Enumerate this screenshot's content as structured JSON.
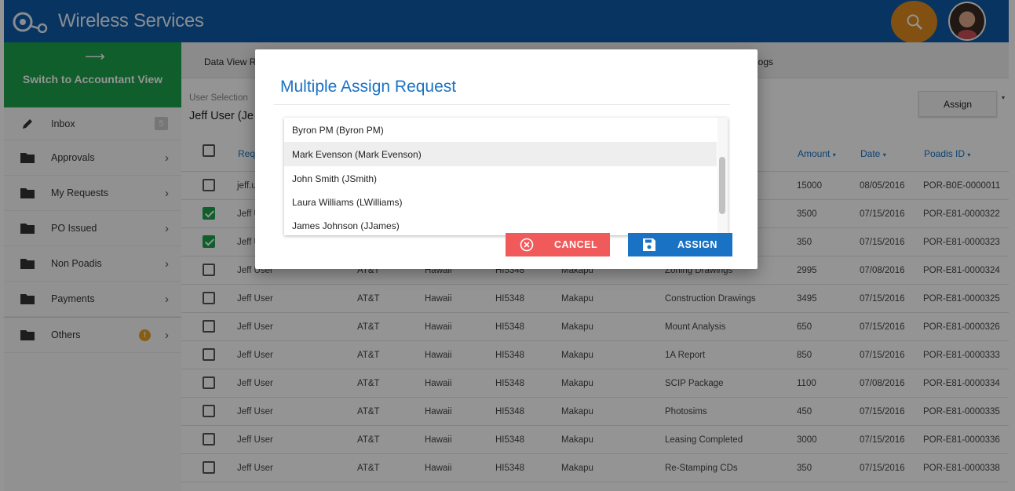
{
  "app": {
    "title": "Wireless Services"
  },
  "sidebar": {
    "switch_label": "Switch to Accountant View",
    "switch_arrow": "⟶",
    "items": [
      {
        "label": "Inbox",
        "icon": "pencil-icon",
        "badge": "5"
      },
      {
        "label": "Approvals",
        "icon": "folder-icon",
        "chevron": "›"
      },
      {
        "label": "My Requests",
        "icon": "folder-icon",
        "chevron": "›"
      },
      {
        "label": "PO Issued",
        "icon": "folder-icon",
        "chevron": "›"
      },
      {
        "label": "Non Poadis",
        "icon": "folder-icon",
        "chevron": "›"
      },
      {
        "label": "Payments",
        "icon": "folder-icon",
        "chevron": "›"
      },
      {
        "label": "Others",
        "icon": "folder-icon",
        "warning": "!",
        "chevron": "›"
      }
    ]
  },
  "main": {
    "tabs": [
      "Data View R",
      "Logs"
    ],
    "user_selection_label": "User Selection",
    "user_selection_value": "Jeff User (Je",
    "assign_button": "Assign",
    "assign_caret": "▾",
    "columns": {
      "requester": "Requ",
      "amount": "Amount",
      "date": "Date",
      "poadis_id": "Poadis ID",
      "sort_indicator": "▾"
    },
    "rows": [
      {
        "checked": false,
        "requester": "jeff.us",
        "carrier": "",
        "region": "",
        "site": "",
        "site_name": "",
        "doc": "",
        "amount": "15000",
        "date": "08/05/2016",
        "poadis_id": "POR-B0E-0000011"
      },
      {
        "checked": true,
        "requester": "Jeff U",
        "carrier": "",
        "region": "",
        "site": "",
        "site_name": "",
        "doc": "",
        "amount": "3500",
        "date": "07/15/2016",
        "poadis_id": "POR-E81-0000322"
      },
      {
        "checked": true,
        "requester": "Jeff U",
        "carrier": "",
        "region": "",
        "site": "",
        "site_name": "",
        "doc": "",
        "amount": "350",
        "date": "07/15/2016",
        "poadis_id": "POR-E81-0000323"
      },
      {
        "checked": false,
        "requester": "Jeff User",
        "carrier": "AT&T",
        "region": "Hawaii",
        "site": "HI5348",
        "site_name": "Makapu",
        "doc": "Zoning Drawings",
        "amount": "2995",
        "date": "07/08/2016",
        "poadis_id": "POR-E81-0000324"
      },
      {
        "checked": false,
        "requester": "Jeff User",
        "carrier": "AT&T",
        "region": "Hawaii",
        "site": "HI5348",
        "site_name": "Makapu",
        "doc": "Construction Drawings",
        "amount": "3495",
        "date": "07/15/2016",
        "poadis_id": "POR-E81-0000325"
      },
      {
        "checked": false,
        "requester": "Jeff User",
        "carrier": "AT&T",
        "region": "Hawaii",
        "site": "HI5348",
        "site_name": "Makapu",
        "doc": "Mount Analysis",
        "amount": "650",
        "date": "07/15/2016",
        "poadis_id": "POR-E81-0000326"
      },
      {
        "checked": false,
        "requester": "Jeff User",
        "carrier": "AT&T",
        "region": "Hawaii",
        "site": "HI5348",
        "site_name": "Makapu",
        "doc": "1A Report",
        "amount": "850",
        "date": "07/15/2016",
        "poadis_id": "POR-E81-0000333"
      },
      {
        "checked": false,
        "requester": "Jeff User",
        "carrier": "AT&T",
        "region": "Hawaii",
        "site": "HI5348",
        "site_name": "Makapu",
        "doc": "SCIP Package",
        "amount": "1100",
        "date": "07/08/2016",
        "poadis_id": "POR-E81-0000334"
      },
      {
        "checked": false,
        "requester": "Jeff User",
        "carrier": "AT&T",
        "region": "Hawaii",
        "site": "HI5348",
        "site_name": "Makapu",
        "doc": "Photosims",
        "amount": "450",
        "date": "07/15/2016",
        "poadis_id": "POR-E81-0000335"
      },
      {
        "checked": false,
        "requester": "Jeff User",
        "carrier": "AT&T",
        "region": "Hawaii",
        "site": "HI5348",
        "site_name": "Makapu",
        "doc": "Leasing Completed",
        "amount": "3000",
        "date": "07/15/2016",
        "poadis_id": "POR-E81-0000336"
      },
      {
        "checked": false,
        "requester": "Jeff User",
        "carrier": "AT&T",
        "region": "Hawaii",
        "site": "HI5348",
        "site_name": "Makapu",
        "doc": "Re-Stamping CDs",
        "amount": "350",
        "date": "07/15/2016",
        "poadis_id": "POR-E81-0000338"
      }
    ]
  },
  "modal": {
    "title": "Multiple Assign Request",
    "options": [
      "Byron PM (Byron PM)",
      "Mark Evenson (Mark Evenson)",
      "John Smith (JSmith)",
      "Laura Williams (LWilliams)",
      "James Johnson (JJames)"
    ],
    "highlighted_index": 1,
    "cancel_label": "CANCEL",
    "assign_label": "ASSIGN"
  },
  "colors": {
    "header": "#0d5aa7",
    "accent_green": "#1aa34a",
    "search_orange": "#e08a1e",
    "cancel_red": "#f05a5a",
    "assign_blue": "#1a72c4"
  }
}
